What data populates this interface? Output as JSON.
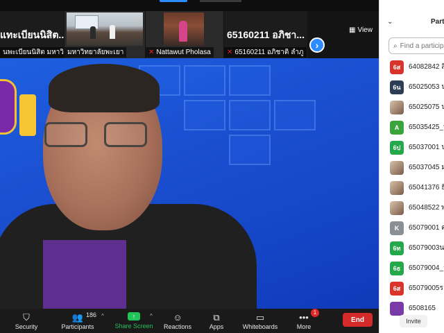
{
  "filmstrip": {
    "tiles": [
      {
        "big_name": "แทะเบียนนิสิต...",
        "tag": "นพะเบียนนิสิต มหาวิทยา..."
      },
      {
        "tag": "มหาวิทยาลัยพะเยา"
      },
      {
        "tag": "Nattawut Pholasa"
      },
      {
        "big_name": "65160211 อภิชา...",
        "tag": "65160211 อภิชาติ ลำภู"
      }
    ],
    "view_label": "View"
  },
  "toolbar": {
    "security": "Security",
    "participants": "Participants",
    "participant_count": "186",
    "share": "Share Screen",
    "reactions": "Reactions",
    "apps": "Apps",
    "whiteboards": "Whiteboards",
    "more": "More",
    "more_badge": "1",
    "end": "End"
  },
  "panel": {
    "title": "Parti",
    "search_placeholder": "Find a participa",
    "invite": "Invite",
    "participants": [
      {
        "avatar": "6ส",
        "color": "#d9332b",
        "name": "64082842 สิ"
      },
      {
        "avatar": "6น",
        "color": "#2c3e55",
        "name": "65025053 น"
      },
      {
        "avatar": "",
        "color": "#b08060",
        "photo": true,
        "name": "65025075 น"
      },
      {
        "avatar": "A",
        "color": "#3aa53a",
        "name": "65035425_น"
      },
      {
        "avatar": "6ป",
        "color": "#24a84a",
        "name": "65037001 ป"
      },
      {
        "avatar": "",
        "color": "#a07060",
        "photo": true,
        "name": "65037045 ม"
      },
      {
        "avatar": "",
        "color": "#607080",
        "photo": true,
        "name": "65041376 ธิ"
      },
      {
        "avatar": "",
        "color": "#506070",
        "photo": true,
        "name": "65048522 พ"
      },
      {
        "avatar": "K",
        "color": "#8a8f96",
        "name": "65079001 ค"
      },
      {
        "avatar": "6ท",
        "color": "#24a84a",
        "name": "65079003น"
      },
      {
        "avatar": "6ธ",
        "color": "#24a84a",
        "name": "65079004_ร"
      },
      {
        "avatar": "6ส",
        "color": "#d9332b",
        "name": "65079005ร"
      },
      {
        "avatar": "",
        "color": "#7a3aa8",
        "name": "6508165"
      }
    ]
  }
}
